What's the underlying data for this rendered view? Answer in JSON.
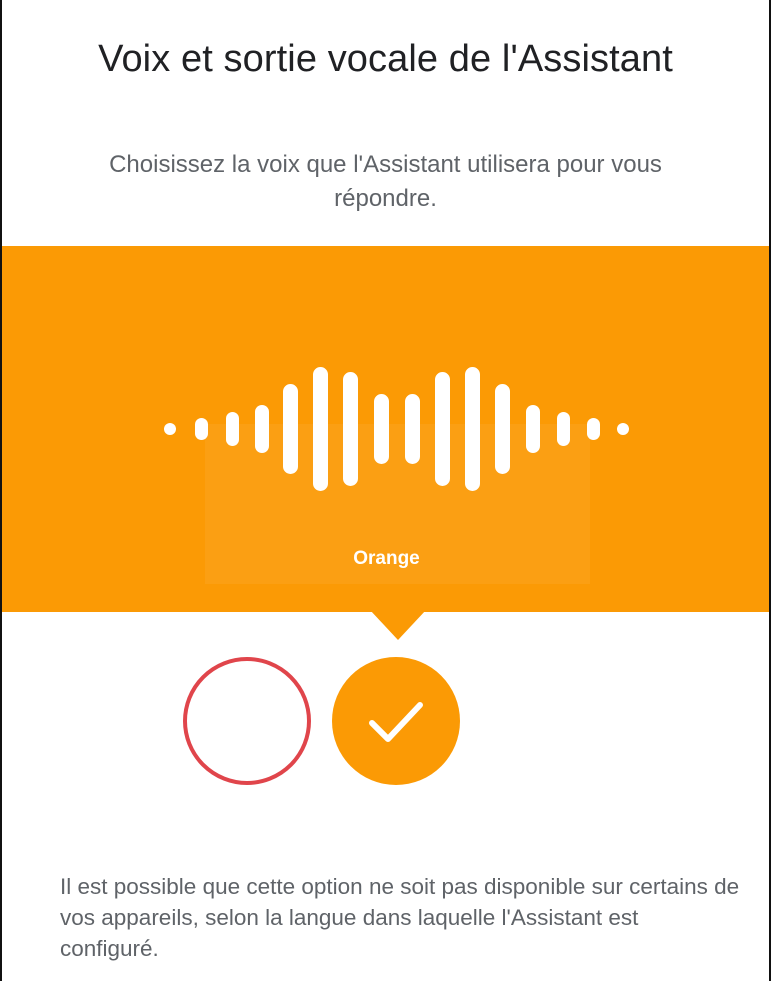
{
  "header": {
    "title": "Voix et sortie vocale de l'Assistant",
    "subtitle": "Choisissez la voix que l'Assistant utilisera pour vous répondre."
  },
  "banner": {
    "voice_name": "Orange",
    "color": "#fb9a05",
    "icon": "sound-wave-icon"
  },
  "voices": [
    {
      "color": "#e0454b",
      "selected": false
    },
    {
      "color": "#fb9a05",
      "selected": true,
      "icon": "check-icon"
    }
  ],
  "footer": {
    "note": "Il est possible que cette option ne soit pas disponible sur certains de vos appareils, selon la langue dans laquelle l'Assistant est configuré."
  }
}
